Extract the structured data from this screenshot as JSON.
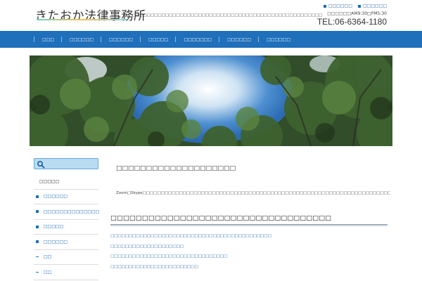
{
  "header": {
    "logo": "きたおか法律事務所",
    "tagline": "□□□□□□□□□□□□□□□□□□□□□□□□□□□□□□□□□□□□□□□□□□□□□□□□□□□□",
    "top_links": [
      "□□□□□□",
      "□□□□□□"
    ],
    "hours": "□□□□□□AM9:30□PM5:30",
    "tel": "TEL:06-6364-1180"
  },
  "nav": {
    "items": [
      "□□□",
      "□□□□□□",
      "□□□□□□",
      "□□□□□",
      "□□□□□□□",
      "□□□□□□",
      "□□□□□□"
    ]
  },
  "hero": {
    "icon": "forest-canopy-photo"
  },
  "sidebar": {
    "search": {
      "placeholder": "",
      "icon": "search-icon"
    },
    "items": [
      {
        "label": "□□□□□",
        "type": "head"
      },
      {
        "label": "□□□□□□",
        "type": "bullet"
      },
      {
        "label": "□□□□□□□□□□□□□□",
        "type": "bullet"
      },
      {
        "label": "□□□□□",
        "type": "bullet"
      },
      {
        "label": "□□□□□□",
        "type": "bullet"
      },
      {
        "label": "□□",
        "type": "dash"
      },
      {
        "label": "□□",
        "type": "dash"
      }
    ]
  },
  "main": {
    "page_heading": "□□□□□□□□□□□□□□□□□□□□",
    "intro": "Zoom□Skype□□□□□□□□□□□□□□□□□□□□□□□□□□□□□□□□□□□□□□□□□□□□□□□□□□□□□□□□□□□□□□□□□□□□□□□□□□ □□□□□□□□□",
    "section_heading": "□□□□□□□□□□□□□□□□□□□□□□□□□□□□□□□□□□□",
    "links": [
      "□□□□□□□□□□□□□□□□□□□□□□□□□□□□□□□□□□□□□□□□□□□□",
      "□□□□□□□□□□□□□□□□□□□□",
      "□□□□□□□□□□□□□□□□□□□□□□□□□□□□□□□□",
      "□□□□□□□□□□□□□□□□□□□□□□□□"
    ]
  },
  "colors": {
    "nav_bg": "#1f6fbb",
    "link": "#1a5fa8",
    "search_bg": "#b9dcf3"
  }
}
